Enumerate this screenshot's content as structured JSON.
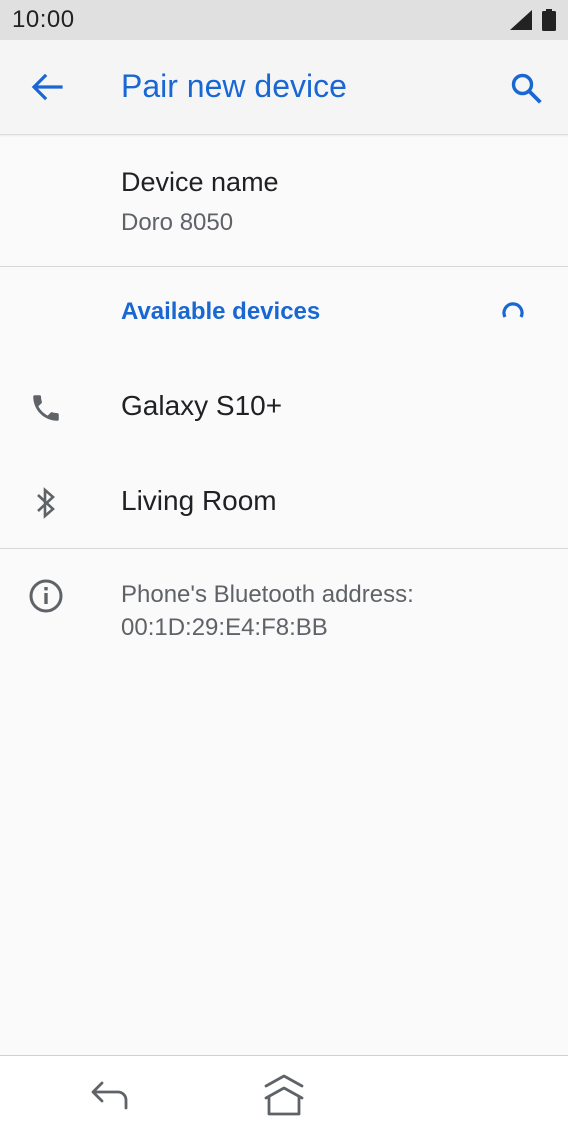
{
  "status_bar": {
    "time": "10:00",
    "icons": [
      "signal-icon",
      "battery-icon"
    ]
  },
  "app_bar": {
    "title": "Pair new device",
    "back_icon": "arrow-left-icon",
    "search_icon": "search-icon"
  },
  "device_name": {
    "title": "Device name",
    "value": "Doro 8050"
  },
  "available": {
    "header": "Available devices",
    "scanning_icon": "spinner-icon",
    "devices": [
      {
        "label": "Galaxy S10+",
        "icon": "phone-icon"
      },
      {
        "label": "Living Room",
        "icon": "bluetooth-icon"
      }
    ]
  },
  "info": {
    "icon": "info-icon",
    "text": "Phone's Bluetooth address: 00:1D:29:E4:F8:BB"
  },
  "nav_bar": {
    "back_icon": "nav-back-icon",
    "home_icon": "nav-home-icon"
  },
  "colors": {
    "accent": "#1967d2",
    "text_primary": "#202124",
    "text_secondary": "#5f6368",
    "icon_gray": "#5f6368",
    "background": "#fafafa"
  }
}
